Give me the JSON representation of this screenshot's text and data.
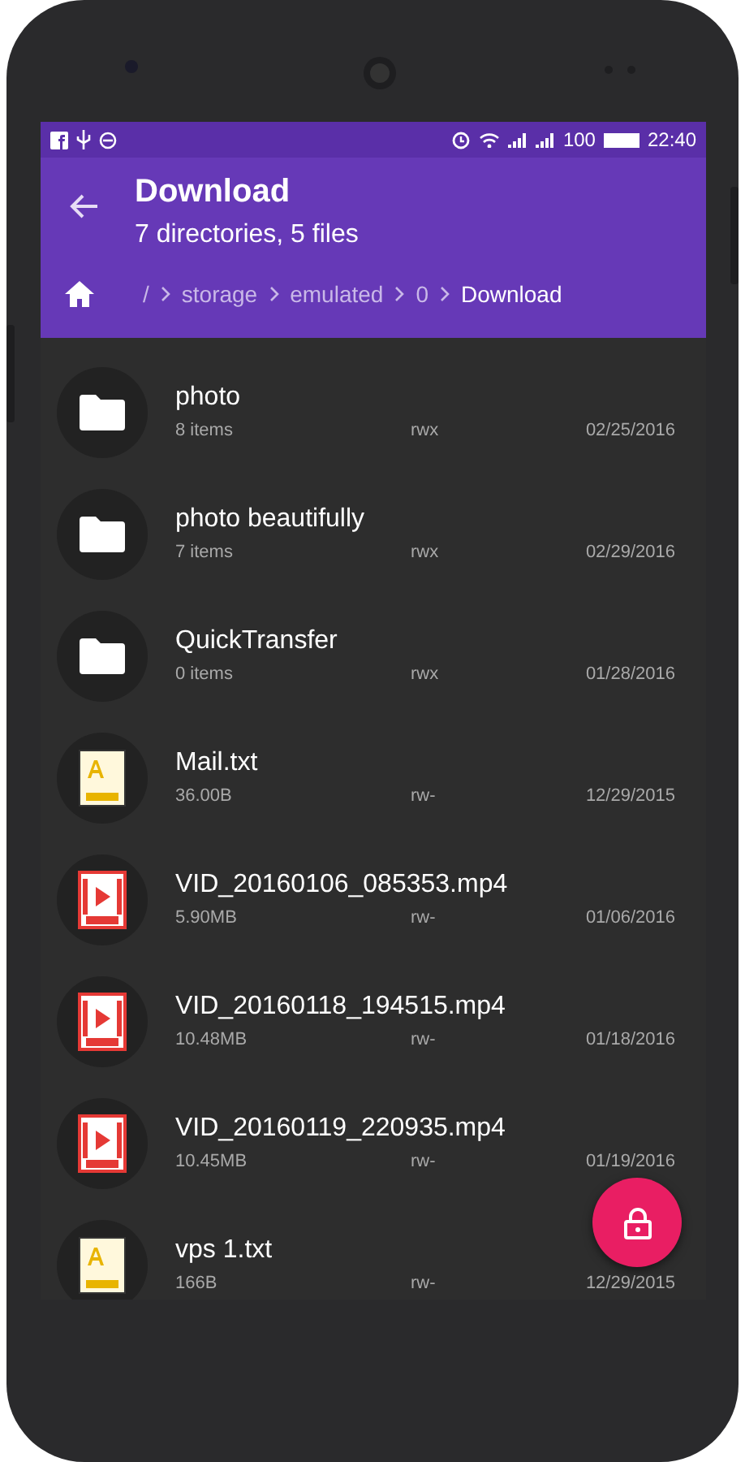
{
  "status_bar": {
    "battery": "100",
    "time": "22:40"
  },
  "toolbar": {
    "title": "Download",
    "subtitle": "7 directories, 5 files"
  },
  "breadcrumbs": [
    {
      "label": "/",
      "selected": false
    },
    {
      "label": "storage",
      "selected": false
    },
    {
      "label": "emulated",
      "selected": false
    },
    {
      "label": "0",
      "selected": false
    },
    {
      "label": "Download",
      "selected": true
    }
  ],
  "files": [
    {
      "kind": "folder",
      "name": "photo",
      "size": "8 items",
      "permissions": "rwx",
      "date": "02/25/2016"
    },
    {
      "kind": "folder",
      "name": "photo beautifully",
      "size": "7 items",
      "permissions": "rwx",
      "date": "02/29/2016"
    },
    {
      "kind": "folder",
      "name": "QuickTransfer",
      "size": "0 items",
      "permissions": "rwx",
      "date": "01/28/2016"
    },
    {
      "kind": "text",
      "name": "Mail.txt",
      "size": "36.00B",
      "permissions": "rw-",
      "date": "12/29/2015"
    },
    {
      "kind": "video",
      "name": "VID_20160106_085353.mp4",
      "size": "5.90MB",
      "permissions": "rw-",
      "date": "01/06/2016"
    },
    {
      "kind": "video",
      "name": "VID_20160118_194515.mp4",
      "size": "10.48MB",
      "permissions": "rw-",
      "date": "01/18/2016"
    },
    {
      "kind": "video",
      "name": "VID_20160119_220935.mp4",
      "size": "10.45MB",
      "permissions": "rw-",
      "date": "01/19/2016"
    },
    {
      "kind": "text",
      "name": "vps 1.txt",
      "size": "166B",
      "permissions": "rw-",
      "date": "12/29/2015"
    }
  ]
}
